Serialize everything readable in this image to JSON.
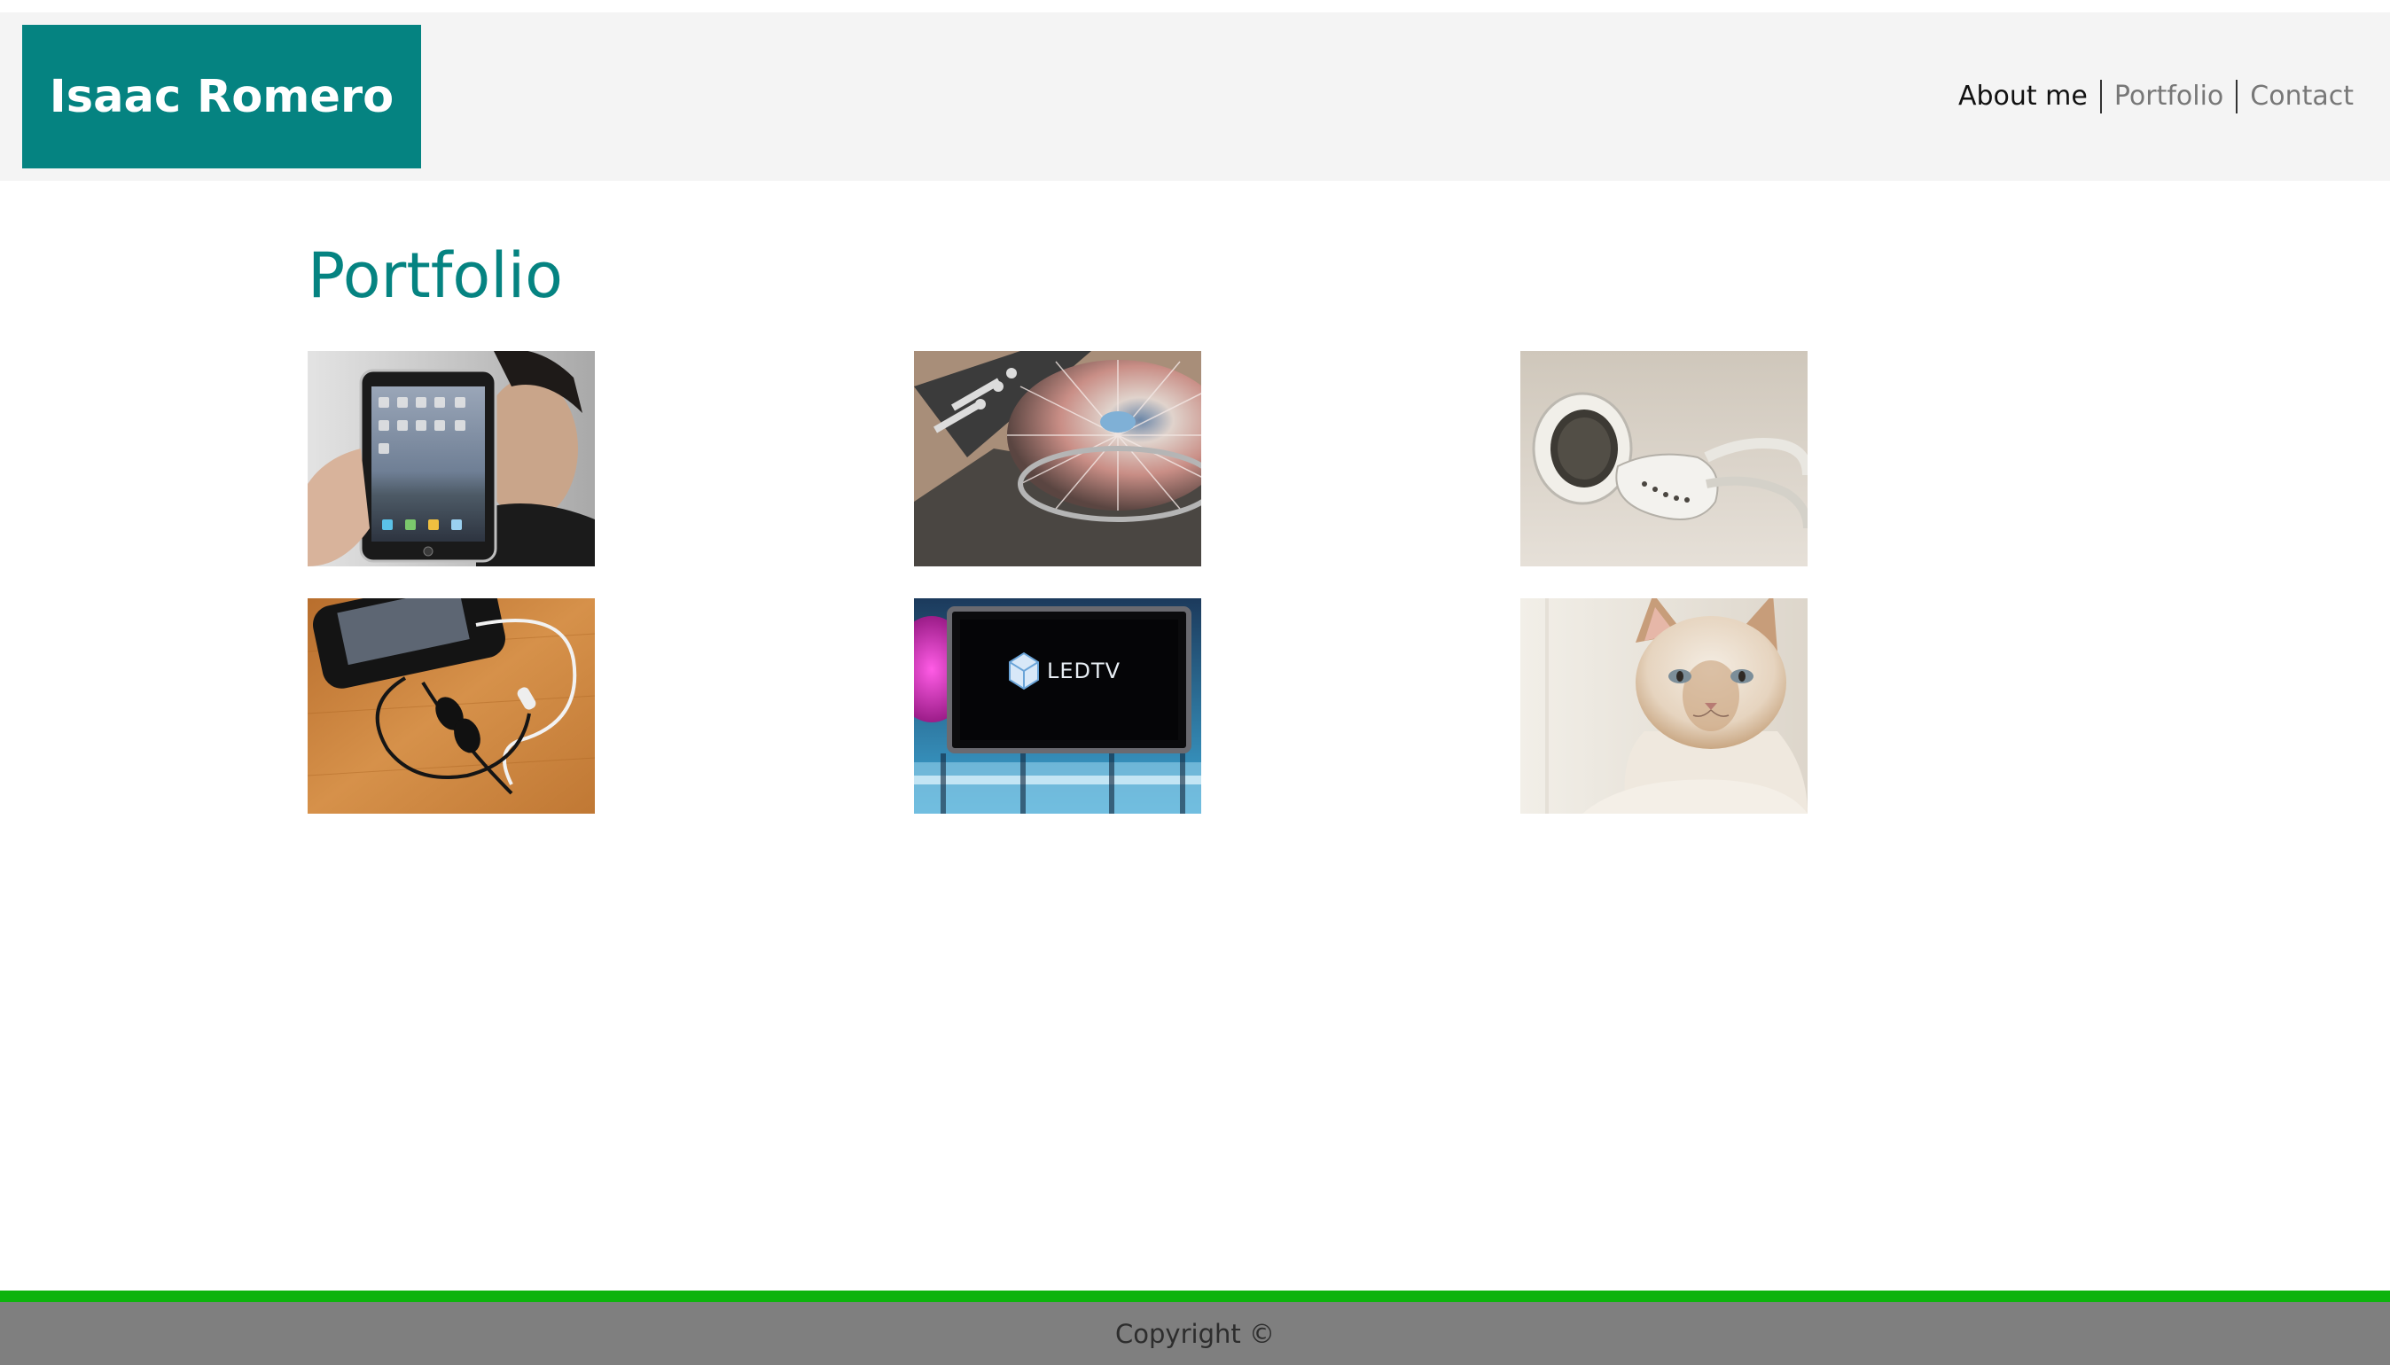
{
  "header": {
    "logo_text": "Isaac Romero",
    "nav": [
      {
        "label": "About me"
      },
      {
        "label": "Portfolio"
      },
      {
        "label": "Contact"
      }
    ]
  },
  "main": {
    "title": "Portfolio"
  },
  "footer": {
    "copyright": "Copyright ©"
  },
  "colors": {
    "brand": "#058381",
    "header_bg": "#f4f4f4",
    "footer_accent": "#0db30d",
    "footer_bg": "#7f7f7f"
  },
  "portfolio": {
    "items": [
      {
        "name": "tablet-photo"
      },
      {
        "name": "turntable-photo"
      },
      {
        "name": "earbuds-photo"
      },
      {
        "name": "phone-earphones-photo"
      },
      {
        "name": "led-tv-photo",
        "caption": "LEDTV"
      },
      {
        "name": "cat-photo"
      }
    ]
  }
}
